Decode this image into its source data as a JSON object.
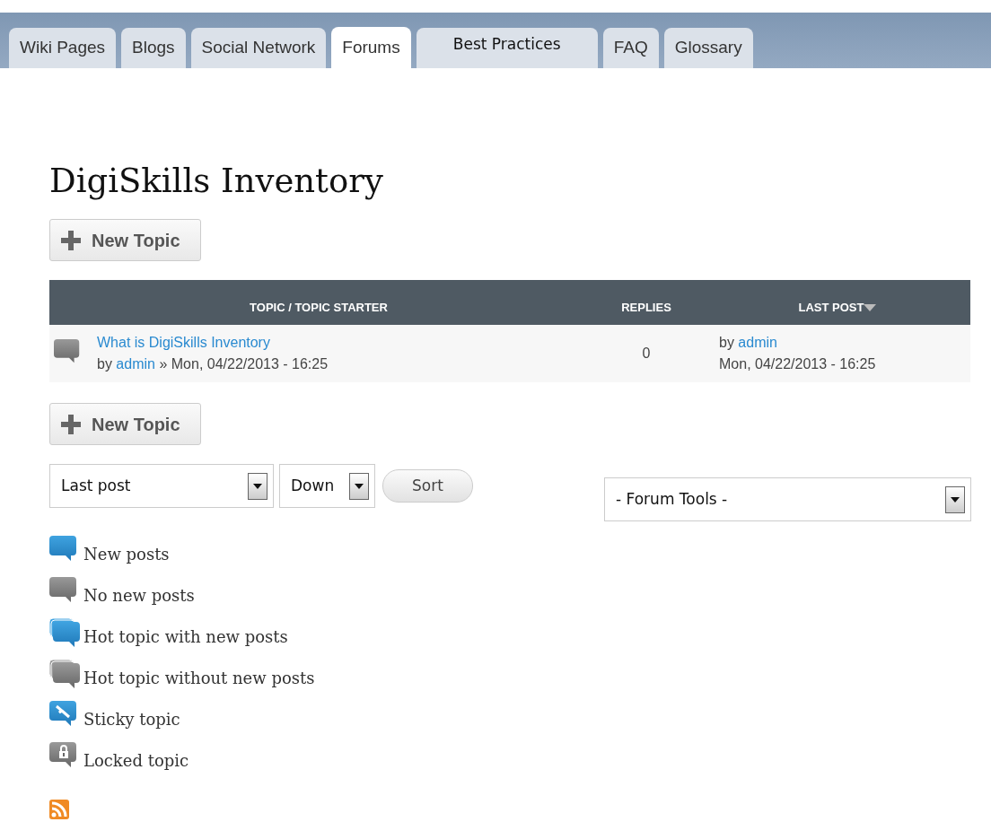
{
  "tabs": [
    {
      "label": "Wiki Pages",
      "selected": false
    },
    {
      "label": "Blogs",
      "selected": false
    },
    {
      "label": "Social Network",
      "selected": false
    },
    {
      "label": "Forums",
      "selected": true
    },
    {
      "label": "Best Practices",
      "selected": false,
      "kind": "wide"
    },
    {
      "label": "FAQ",
      "selected": false
    },
    {
      "label": "Glossary",
      "selected": false
    }
  ],
  "title": "DigiSkills Inventory",
  "new_topic_buttons": [
    "New Topic",
    "New Topic"
  ],
  "table": {
    "columns": [
      {
        "label": "TOPIC / TOPIC STARTER",
        "sorted": false
      },
      {
        "label": "REPLIES",
        "sorted": false
      },
      {
        "label": "LAST POST",
        "sorted": true
      }
    ],
    "rows": [
      {
        "kind": "none",
        "topic": "What is DigiSkills Inventory",
        "by": "by",
        "starter": "admin",
        "sep": "»",
        "date": "Mon, 04/22/2013 - 16:25",
        "replies": "0",
        "last_by": "by",
        "last_user": "admin",
        "last_date": "Mon, 04/22/2013 - 16:25"
      }
    ]
  },
  "sort": {
    "field": "Last post",
    "order": "Down",
    "button": "Sort"
  },
  "forum_tools": "- Forum Tools -",
  "legend": [
    {
      "kind": "new",
      "label": "New posts"
    },
    {
      "kind": "none",
      "label": "No new posts"
    },
    {
      "kind": "hot-new",
      "label": "Hot topic with new posts"
    },
    {
      "kind": "hot-none",
      "label": "Hot topic without new posts"
    },
    {
      "kind": "sticky",
      "label": "Sticky topic"
    },
    {
      "kind": "locked",
      "label": "Locked topic"
    }
  ]
}
